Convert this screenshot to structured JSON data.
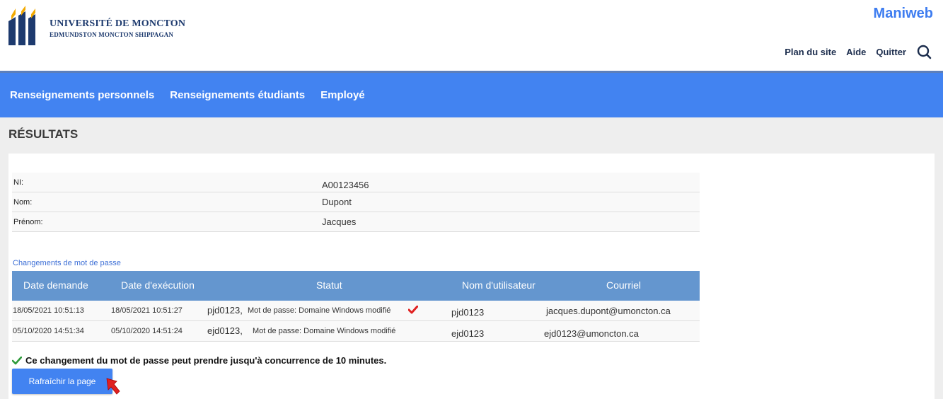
{
  "header": {
    "university_name": "UNIVERSITÉ DE MONCTON",
    "campuses": "EDMUNDSTON  MONCTON  SHIPPAGAN",
    "app_title": "Maniweb",
    "links": [
      "Plan du site",
      "Aide",
      "Quitter"
    ],
    "search_icon": "search-icon"
  },
  "nav": {
    "items": [
      "Renseignements personnels",
      "Renseignements étudiants",
      "Employé"
    ]
  },
  "page": {
    "section_title": "RÉSULTATS"
  },
  "info": {
    "rows": [
      {
        "label": "NI:",
        "value": "A00123456"
      },
      {
        "label": "Nom:",
        "value": "Dupont"
      },
      {
        "label": "Prénom:",
        "value": "Jacques"
      }
    ]
  },
  "password_changes": {
    "caption": "Changements de mot de passe",
    "columns": [
      "Date demande",
      "Date d'exécution",
      "Statut",
      "Nom d'utilisateur",
      "Courriel"
    ],
    "rows": [
      {
        "date_request": "18/05/2021 10:51:13",
        "date_exec": "18/05/2021 10:51:27",
        "status_user": "pjd0123,",
        "status_text": "Mot de passe: Domaine Windows modifié",
        "username": "pjd0123",
        "email": "jacques.dupont@umoncton.ca"
      },
      {
        "date_request": "05/10/2020 14:51:34",
        "date_exec": "05/10/2020 14:51:24",
        "status_user": "ejd0123,",
        "status_text": "Mot de passe: Domaine Windows modifié",
        "username": "ejd0123",
        "email": "ejd0123@umoncton.ca"
      }
    ]
  },
  "notice": {
    "text": "Ce changement du mot de passe peut prendre jusqu'à concurrence de 10 minutes."
  },
  "actions": {
    "refresh_label": "Rafraîchir la page"
  },
  "colors": {
    "accent": "#4283f1",
    "table_header": "#6496cf",
    "check_green": "#2e9a3a",
    "check_red": "#e02020"
  }
}
